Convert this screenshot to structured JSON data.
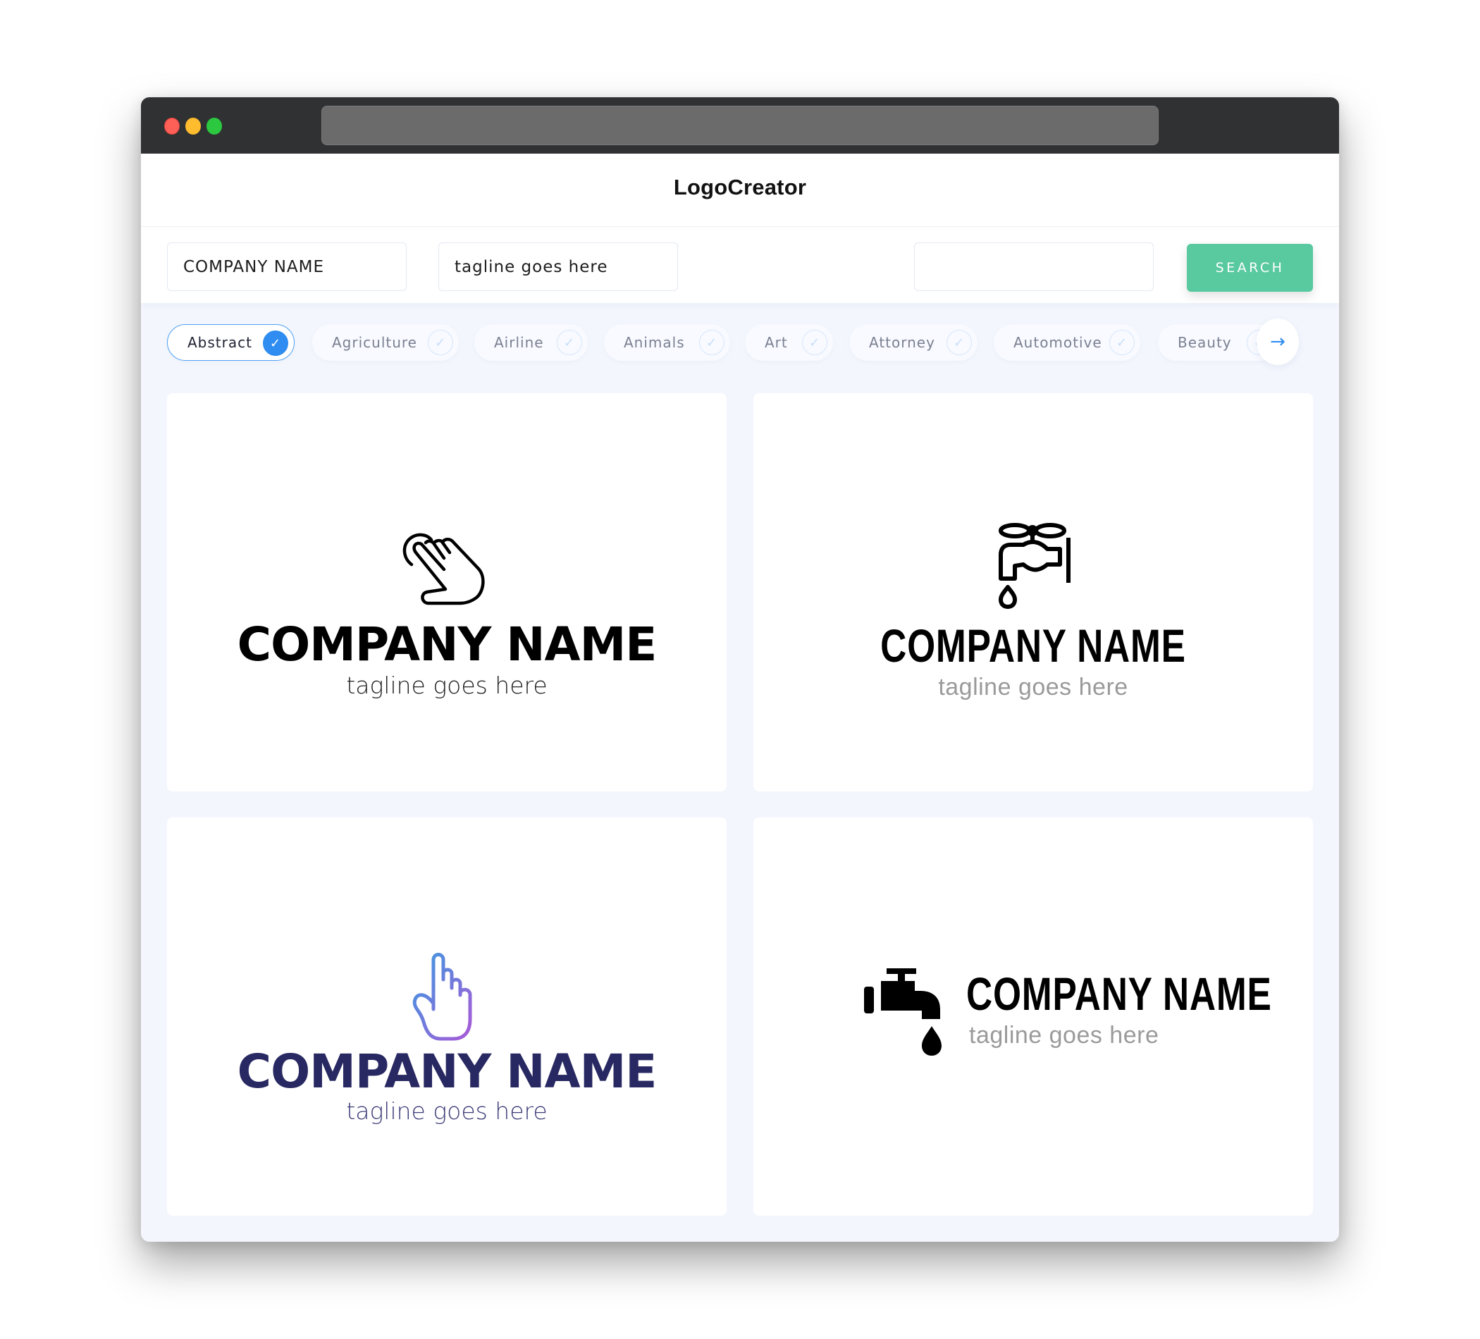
{
  "window": {
    "traffic_lights": [
      "close",
      "minimize",
      "maximize"
    ],
    "url": ""
  },
  "header": {
    "title": "LogoCreator"
  },
  "search": {
    "company_name_value": "COMPANY NAME",
    "tagline_value": "tagline goes here",
    "extra_value": "",
    "button_label": "SEARCH",
    "button_color": "#59c9a0"
  },
  "categories": {
    "items": [
      {
        "label": "Abstract",
        "selected": true
      },
      {
        "label": "Agriculture",
        "selected": false
      },
      {
        "label": "Airline",
        "selected": false
      },
      {
        "label": "Animals",
        "selected": false
      },
      {
        "label": "Art",
        "selected": false
      },
      {
        "label": "Attorney",
        "selected": false
      },
      {
        "label": "Automotive",
        "selected": false
      },
      {
        "label": "Beauty",
        "selected": false
      }
    ],
    "check_glyph": "✓",
    "next_glyph": "→",
    "accent_color": "#2f8cf0"
  },
  "logos": [
    {
      "icon": "pointing-hand-click-icon",
      "company": "COMPANY NAME",
      "tagline": "tagline goes here",
      "name_color": "#000000",
      "tagline_color": "#222222"
    },
    {
      "icon": "water-faucet-outline-icon",
      "company": "COMPANY NAME",
      "tagline": "tagline goes here",
      "name_color": "#000000",
      "tagline_color": "#9a9a9a"
    },
    {
      "icon": "pointing-finger-up-icon",
      "company": "COMPANY NAME",
      "tagline": "tagline goes here",
      "name_color": "#282862",
      "tagline_color": "#3c3c78",
      "gradient": [
        "#3a9be0",
        "#a85ad8"
      ]
    },
    {
      "icon": "water-faucet-solid-icon",
      "company": "COMPANY NAME",
      "tagline": "tagline goes here",
      "name_color": "#000000",
      "tagline_color": "#9a9a9a"
    }
  ]
}
